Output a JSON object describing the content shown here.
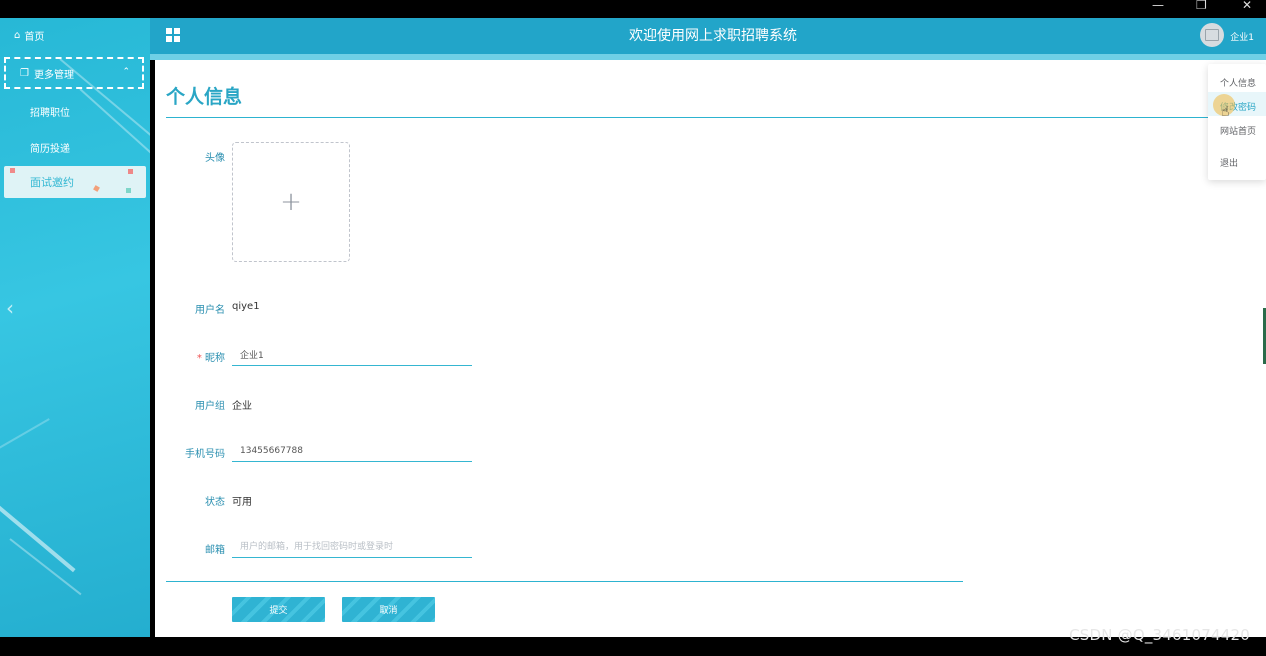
{
  "window": {
    "controls": [
      "—",
      "❐",
      "✕"
    ]
  },
  "sidebar": {
    "home_label": "首页",
    "group_label": "更多管理",
    "items": [
      {
        "label": "招聘职位"
      },
      {
        "label": "简历投递"
      },
      {
        "label": "面试邀约",
        "active": true
      }
    ]
  },
  "header": {
    "title": "欢迎使用网上求职招聘系统",
    "user": "企业1"
  },
  "user_menu": {
    "items": [
      "个人信息",
      "修改密码",
      "网站首页",
      "退出"
    ],
    "hovered": "修改密码"
  },
  "form": {
    "page_title": "个人信息",
    "avatar_label": "头像",
    "upload_icon": "+",
    "username_label": "用户名",
    "username_value": "qiye1",
    "nickname_required_mark": "*",
    "nickname_label": "昵称",
    "nickname_value": "企业1",
    "group_label": "用户组",
    "group_value": "企业",
    "phone_label": "手机号码",
    "phone_value": "13455667788",
    "status_label": "状态",
    "status_value": "可用",
    "email_label": "邮箱",
    "email_placeholder": "用户的邮箱，用于找回密码时或登录时",
    "submit_label": "提交",
    "cancel_label": "取消"
  },
  "watermark": "CSDN @Q_3461074420",
  "colors": {
    "accent": "#22a5c9",
    "sidebar": "#37c6e2",
    "text_label": "#2a8fb0"
  }
}
